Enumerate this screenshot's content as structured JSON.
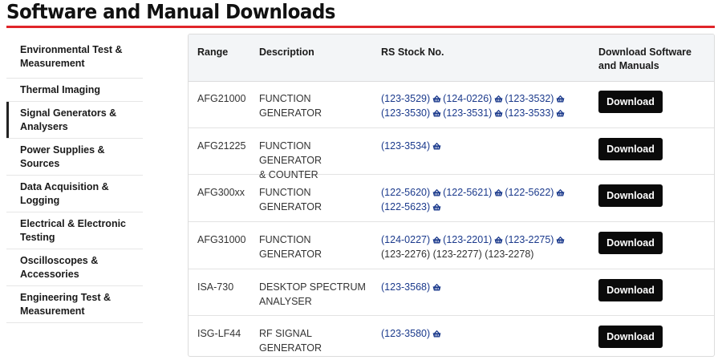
{
  "page": {
    "title": "Software and Manual Downloads"
  },
  "sidebar": {
    "items": [
      {
        "label_lines": [
          "Environmental Test &",
          "Measurement"
        ],
        "active": false
      },
      {
        "label_lines": [
          "Thermal Imaging"
        ],
        "active": false
      },
      {
        "label_lines": [
          "Signal Generators &",
          "Analysers"
        ],
        "active": true
      },
      {
        "label_lines": [
          "Power Supplies &",
          "Sources"
        ],
        "active": false
      },
      {
        "label_lines": [
          "Data Acquisition &",
          "Logging"
        ],
        "active": false
      },
      {
        "label_lines": [
          "Electrical & Electronic",
          "Testing"
        ],
        "active": false
      },
      {
        "label_lines": [
          "Oscilloscopes &",
          "Accessories"
        ],
        "active": false
      },
      {
        "label_lines": [
          "Engineering Test &",
          "Measurement"
        ],
        "active": false
      }
    ]
  },
  "table": {
    "headers": {
      "range": "Range",
      "description": "Description",
      "stock": "RS Stock No.",
      "download": [
        "Download Software",
        "and Manuals"
      ]
    },
    "download_label": "Download",
    "rows": [
      {
        "range": "AFG21000",
        "description": [
          "FUNCTION GENERATOR"
        ],
        "stock_lines": [
          [
            {
              "no": "(123-3529)",
              "linked": true
            },
            {
              "no": "(124-0226)",
              "linked": true
            },
            {
              "no": "(123-3532)",
              "linked": true
            }
          ],
          [
            {
              "no": "(123-3530)",
              "linked": true
            },
            {
              "no": "(123-3531)",
              "linked": true
            },
            {
              "no": "(123-3533)",
              "linked": true
            }
          ]
        ]
      },
      {
        "range": "AFG21225",
        "description": [
          "FUNCTION GENERATOR",
          "& COUNTER"
        ],
        "stock_lines": [
          [
            {
              "no": "(123-3534)",
              "linked": true
            }
          ]
        ]
      },
      {
        "range": "AFG300xx",
        "description": [
          "FUNCTION GENERATOR"
        ],
        "stock_lines": [
          [
            {
              "no": "(122-5620)",
              "linked": true
            },
            {
              "no": "(122-5621)",
              "linked": true
            },
            {
              "no": "(122-5622)",
              "linked": true
            }
          ],
          [
            {
              "no": "(122-5623)",
              "linked": true
            }
          ]
        ]
      },
      {
        "range": "AFG31000",
        "description": [
          "FUNCTION GENERATOR"
        ],
        "stock_lines": [
          [
            {
              "no": "(124-0227)",
              "linked": true
            },
            {
              "no": "(123-2201)",
              "linked": true
            },
            {
              "no": "(123-2275)",
              "linked": true
            }
          ],
          [
            {
              "no": "(123-2276)",
              "linked": false
            },
            {
              "no": "(123-2277)",
              "linked": false
            },
            {
              "no": "(123-2278)",
              "linked": false
            }
          ]
        ]
      },
      {
        "range": "ISA-730",
        "description": [
          "DESKTOP SPECTRUM",
          "ANALYSER"
        ],
        "stock_lines": [
          [
            {
              "no": "(123-3568)",
              "linked": true
            }
          ]
        ]
      },
      {
        "range": "ISG-LF44",
        "description": [
          "RF SIGNAL GENERATOR"
        ],
        "stock_lines": [
          [
            {
              "no": "(123-3580)",
              "linked": true
            }
          ]
        ]
      }
    ]
  },
  "colors": {
    "accent_red": "#e0252a",
    "link_blue": "#1b3a8c",
    "button_black": "#0a0a0a"
  },
  "icons": {
    "stock_action": "basket-icon"
  }
}
